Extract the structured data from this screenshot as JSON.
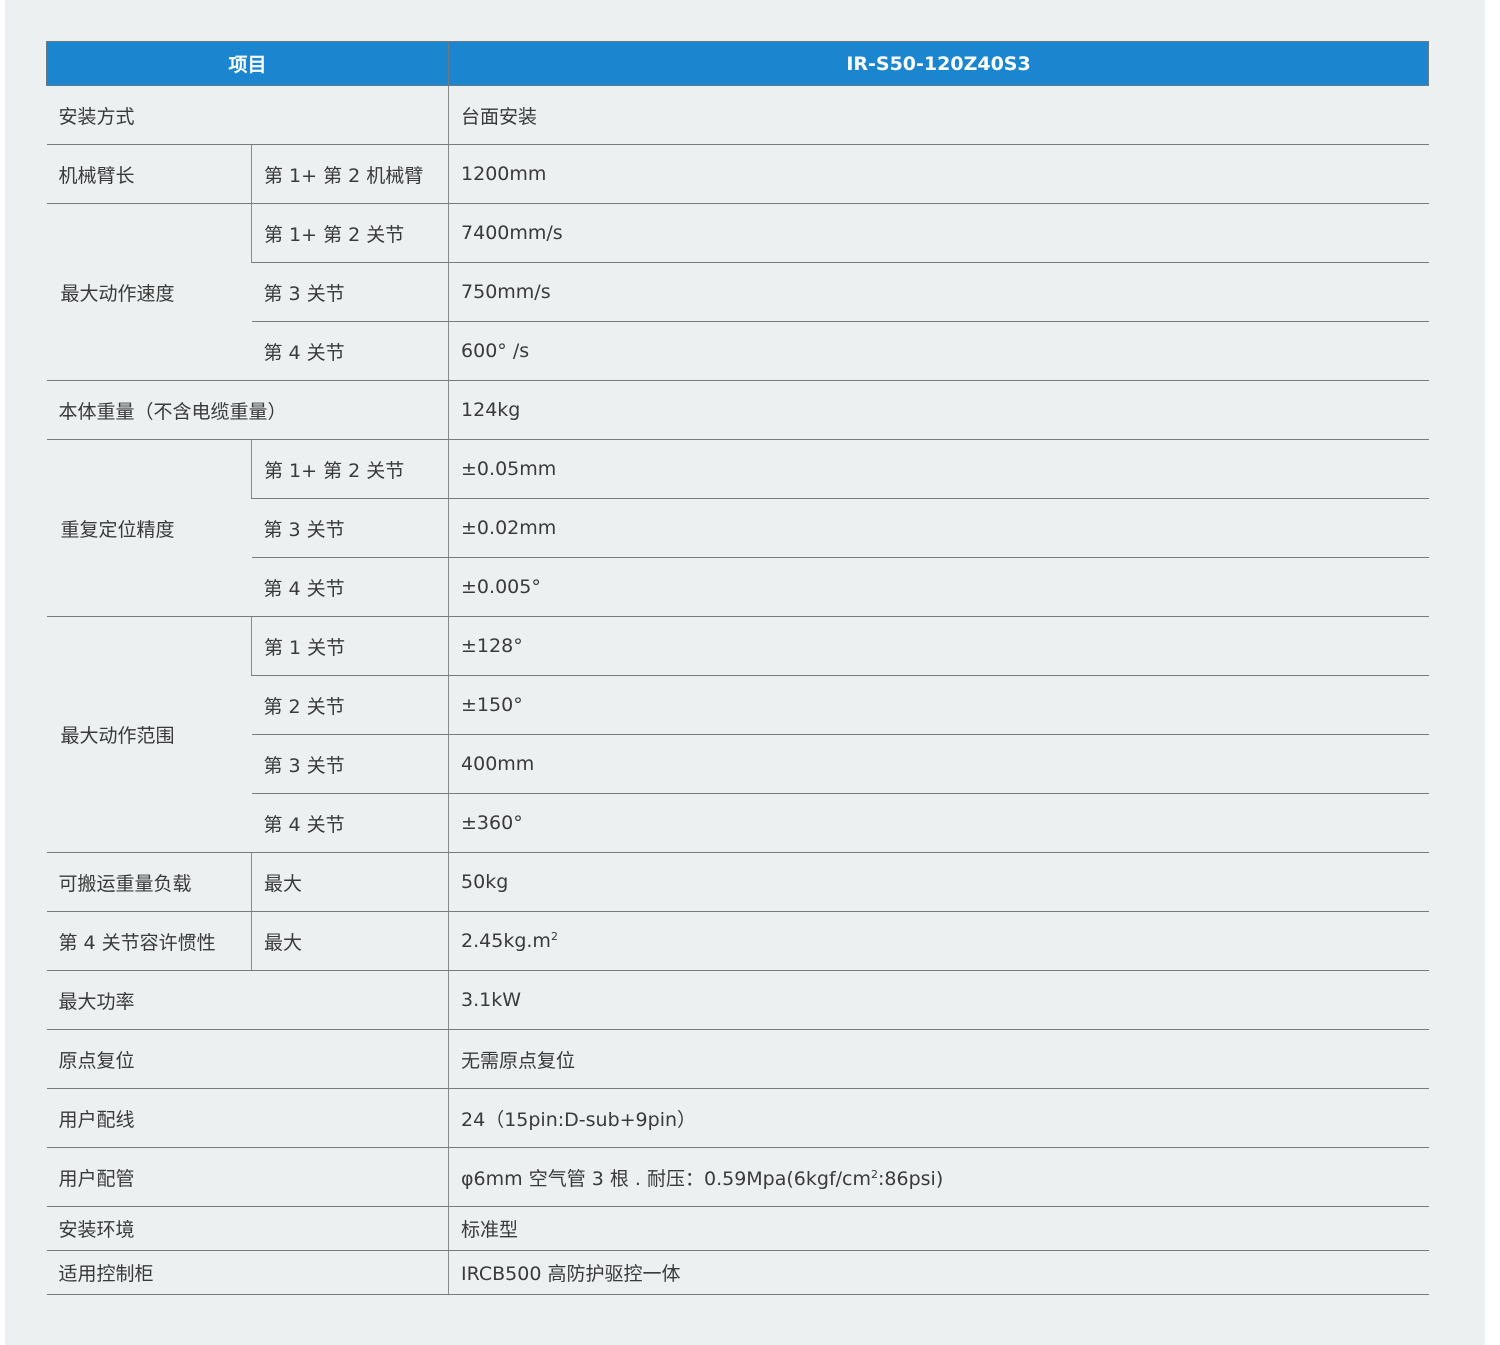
{
  "header": {
    "item": "项目",
    "model": "IR-S50-120Z40S3"
  },
  "rows": {
    "install": {
      "label": "安装方式",
      "value": "台面安装"
    },
    "arm": {
      "label": "机械臂长",
      "sub": "第 1+ 第 2 机械臂",
      "value": "1200mm"
    },
    "speed": {
      "label": "最大动作速度",
      "r1": {
        "sub": "第 1+ 第 2 关节",
        "value": "7400mm/s"
      },
      "r2": {
        "sub": "第 3 关节",
        "value": "750mm/s"
      },
      "r3": {
        "sub": "第 4 关节",
        "value": "600° /s"
      }
    },
    "weight": {
      "label": "本体重量（不含电缆重量）",
      "value": "124kg"
    },
    "repeat": {
      "label": "重复定位精度",
      "r1": {
        "sub": "第 1+ 第 2 关节",
        "value": "±0.05mm"
      },
      "r2": {
        "sub": "第 3 关节",
        "value": "±0.02mm"
      },
      "r3": {
        "sub": "第 4 关节",
        "value": "±0.005°"
      }
    },
    "range": {
      "label": "最大动作范围",
      "r1": {
        "sub": "第 1 关节",
        "value": "±128°"
      },
      "r2": {
        "sub": "第 2 关节",
        "value": "±150°"
      },
      "r3": {
        "sub": "第 3 关节",
        "value": "400mm"
      },
      "r4": {
        "sub": "第 4 关节",
        "value": "±360°"
      }
    },
    "payload": {
      "label": "可搬运重量负载",
      "sub": "最大",
      "value": "50kg"
    },
    "inertia": {
      "label": "第 4 关节容许惯性",
      "sub": "最大",
      "value": "2.45kg.m",
      "value_sup": "2"
    },
    "power": {
      "label": "最大功率",
      "value": "3.1kW"
    },
    "homing": {
      "label": "原点复位",
      "value": "无需原点复位"
    },
    "wiring": {
      "label": "用户配线",
      "value": "24（15pin:D-sub+9pin）"
    },
    "piping": {
      "label": "用户配管",
      "value_a": "φ6mm 空气管 3 根 . 耐压：0.59Mpa(6kgf/cm",
      "value_sup": "2",
      "value_b": ":86psi)"
    },
    "env": {
      "label": "安装环境",
      "value": "标准型"
    },
    "controller": {
      "label": "适用控制柜",
      "value": "IRCB500 高防护驱控一体"
    }
  }
}
